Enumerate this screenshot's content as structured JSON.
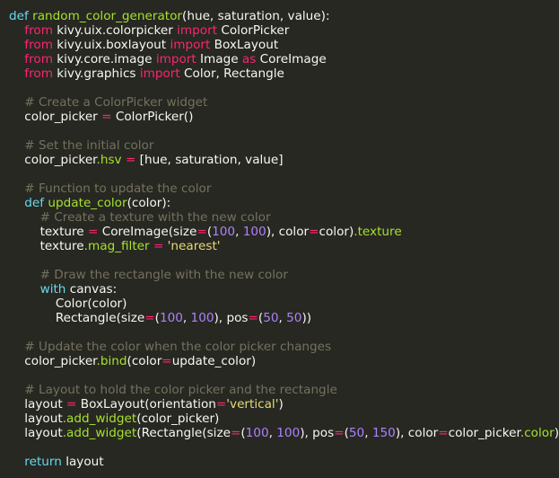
{
  "editor": {
    "background": "#272822",
    "colors": {
      "plain": "#f8f8f2",
      "keyword": "#66d9ef",
      "import_keyword": "#f92672",
      "function": "#a6e22e",
      "operator": "#f92672",
      "number": "#ae81ff",
      "string": "#e6db74",
      "comment": "#75715e"
    },
    "lines": [
      [
        [
          "keyword",
          "def"
        ],
        [
          "plain",
          " "
        ],
        [
          "function",
          "random_color_generator"
        ],
        [
          "plain",
          "(hue, saturation, value):"
        ]
      ],
      [
        [
          "plain",
          "    "
        ],
        [
          "keyword-import",
          "from"
        ],
        [
          "plain",
          " kivy.uix.colorpicker "
        ],
        [
          "keyword-import",
          "import"
        ],
        [
          "plain",
          " ColorPicker"
        ]
      ],
      [
        [
          "plain",
          "    "
        ],
        [
          "keyword-import",
          "from"
        ],
        [
          "plain",
          " kivy.uix.boxlayout "
        ],
        [
          "keyword-import",
          "import"
        ],
        [
          "plain",
          " BoxLayout"
        ]
      ],
      [
        [
          "plain",
          "    "
        ],
        [
          "keyword-import",
          "from"
        ],
        [
          "plain",
          " kivy.core.image "
        ],
        [
          "keyword-import",
          "import"
        ],
        [
          "plain",
          " Image "
        ],
        [
          "keyword-import",
          "as"
        ],
        [
          "plain",
          " CoreImage"
        ]
      ],
      [
        [
          "plain",
          "    "
        ],
        [
          "keyword-import",
          "from"
        ],
        [
          "plain",
          " kivy.graphics "
        ],
        [
          "keyword-import",
          "import"
        ],
        [
          "plain",
          " Color, Rectangle"
        ]
      ],
      [],
      [
        [
          "plain",
          "    "
        ],
        [
          "comment",
          "# Create a ColorPicker widget"
        ]
      ],
      [
        [
          "plain",
          "    color_picker "
        ],
        [
          "operator",
          "="
        ],
        [
          "plain",
          " ColorPicker()"
        ]
      ],
      [],
      [
        [
          "plain",
          "    "
        ],
        [
          "comment",
          "# Set the initial color"
        ]
      ],
      [
        [
          "plain",
          "    color_picker"
        ],
        [
          "attr",
          ".hsv"
        ],
        [
          "plain",
          " "
        ],
        [
          "operator",
          "="
        ],
        [
          "plain",
          " [hue, saturation, value]"
        ]
      ],
      [],
      [
        [
          "plain",
          "    "
        ],
        [
          "comment",
          "# Function to update the color"
        ]
      ],
      [
        [
          "plain",
          "    "
        ],
        [
          "keyword",
          "def"
        ],
        [
          "plain",
          " "
        ],
        [
          "function",
          "update_color"
        ],
        [
          "plain",
          "(color):"
        ]
      ],
      [
        [
          "plain",
          "        "
        ],
        [
          "comment",
          "# Create a texture with the new color"
        ]
      ],
      [
        [
          "plain",
          "        texture "
        ],
        [
          "operator",
          "="
        ],
        [
          "plain",
          " CoreImage(size"
        ],
        [
          "operator",
          "="
        ],
        [
          "plain",
          "("
        ],
        [
          "number",
          "100"
        ],
        [
          "plain",
          ", "
        ],
        [
          "number",
          "100"
        ],
        [
          "plain",
          "), color"
        ],
        [
          "operator",
          "="
        ],
        [
          "plain",
          "color)"
        ],
        [
          "attr",
          ".texture"
        ]
      ],
      [
        [
          "plain",
          "        texture"
        ],
        [
          "attr",
          ".mag_filter"
        ],
        [
          "plain",
          " "
        ],
        [
          "operator",
          "="
        ],
        [
          "plain",
          " "
        ],
        [
          "string",
          "'nearest'"
        ]
      ],
      [],
      [
        [
          "plain",
          "        "
        ],
        [
          "comment",
          "# Draw the rectangle with the new color"
        ]
      ],
      [
        [
          "plain",
          "        "
        ],
        [
          "keyword",
          "with"
        ],
        [
          "plain",
          " canvas:"
        ]
      ],
      [
        [
          "plain",
          "            Color(color)"
        ]
      ],
      [
        [
          "plain",
          "            Rectangle(size"
        ],
        [
          "operator",
          "="
        ],
        [
          "plain",
          "("
        ],
        [
          "number",
          "100"
        ],
        [
          "plain",
          ", "
        ],
        [
          "number",
          "100"
        ],
        [
          "plain",
          "), pos"
        ],
        [
          "operator",
          "="
        ],
        [
          "plain",
          "("
        ],
        [
          "number",
          "50"
        ],
        [
          "plain",
          ", "
        ],
        [
          "number",
          "50"
        ],
        [
          "plain",
          "))"
        ]
      ],
      [],
      [
        [
          "plain",
          "    "
        ],
        [
          "comment",
          "# Update the color when the color picker changes"
        ]
      ],
      [
        [
          "plain",
          "    color_picker"
        ],
        [
          "attr",
          ".bind"
        ],
        [
          "plain",
          "(color"
        ],
        [
          "operator",
          "="
        ],
        [
          "plain",
          "update_color)"
        ]
      ],
      [],
      [
        [
          "plain",
          "    "
        ],
        [
          "comment",
          "# Layout to hold the color picker and the rectangle"
        ]
      ],
      [
        [
          "plain",
          "    layout "
        ],
        [
          "operator",
          "="
        ],
        [
          "plain",
          " BoxLayout(orientation"
        ],
        [
          "operator",
          "="
        ],
        [
          "string",
          "'vertical'"
        ],
        [
          "plain",
          ")"
        ]
      ],
      [
        [
          "plain",
          "    layout"
        ],
        [
          "attr",
          ".add_widget"
        ],
        [
          "plain",
          "(color_picker)"
        ]
      ],
      [
        [
          "plain",
          "    layout"
        ],
        [
          "attr",
          ".add_widget"
        ],
        [
          "plain",
          "(Rectangle(size"
        ],
        [
          "operator",
          "="
        ],
        [
          "plain",
          "("
        ],
        [
          "number",
          "100"
        ],
        [
          "plain",
          ", "
        ],
        [
          "number",
          "100"
        ],
        [
          "plain",
          "), pos"
        ],
        [
          "operator",
          "="
        ],
        [
          "plain",
          "("
        ],
        [
          "number",
          "50"
        ],
        [
          "plain",
          ", "
        ],
        [
          "number",
          "150"
        ],
        [
          "plain",
          "), color"
        ],
        [
          "operator",
          "="
        ],
        [
          "plain",
          "color_picker"
        ],
        [
          "attr",
          ".color"
        ],
        [
          "plain",
          "))"
        ]
      ],
      [],
      [
        [
          "plain",
          "    "
        ],
        [
          "keyword",
          "return"
        ],
        [
          "plain",
          " layout"
        ]
      ]
    ]
  }
}
